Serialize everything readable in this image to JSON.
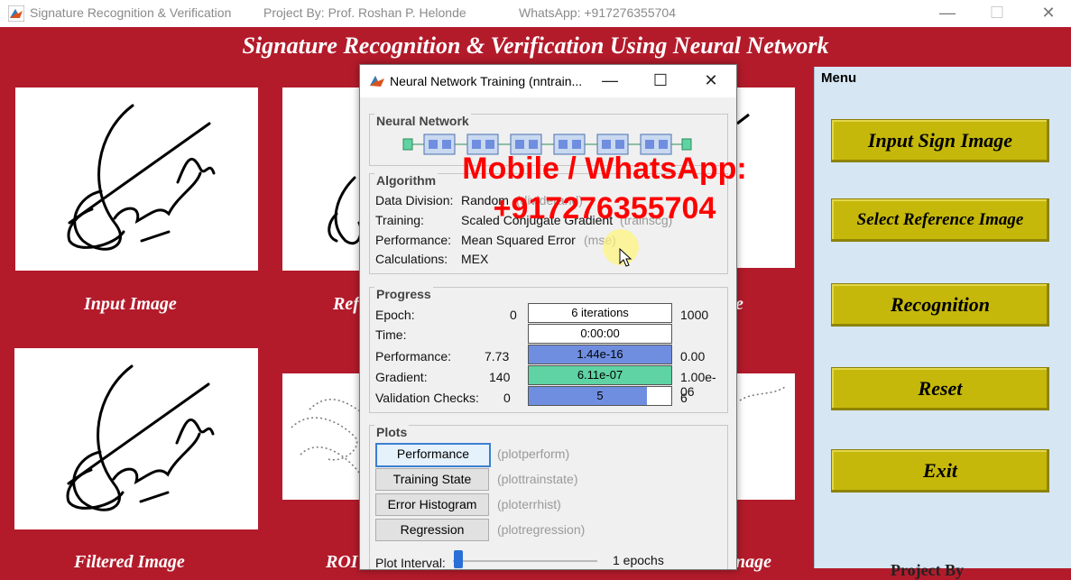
{
  "window": {
    "title": "Signature Recognition & Verification",
    "project": "Project By: Prof. Roshan P. Helonde",
    "whatsapp": "WhatsApp: +917276355704",
    "minimize": "—",
    "maximize": "☐",
    "close": "✕"
  },
  "banner": "Signature Recognition & Verification Using Neural Network",
  "panels": {
    "input_caption": "Input Image",
    "ref_caption": "Ref",
    "third_caption": "e",
    "filtered_caption": "Filtered Image",
    "roi_caption": "ROI",
    "sixth_caption": "nage"
  },
  "menu": {
    "title": "Menu",
    "buttons": [
      "Input Sign Image",
      "Select Reference Image",
      "Recognition",
      "Reset",
      "Exit"
    ],
    "footer": "Project By"
  },
  "dialog": {
    "title": "Neural Network Training (nntrain...",
    "minimize": "—",
    "maximize": "☐",
    "close": "✕",
    "network_title": "Neural Network",
    "algorithms": {
      "title": "Algorithm",
      "rows": [
        {
          "label": "Data Division:",
          "value": "Random",
          "code": "(dividerand)"
        },
        {
          "label": "Training:",
          "value": "Scaled Conjugate Gradient",
          "code": "(trainscg)"
        },
        {
          "label": "Performance:",
          "value": "Mean Squared Error",
          "code": "(mse)"
        },
        {
          "label": "Calculations:",
          "value": "MEX",
          "code": ""
        }
      ]
    },
    "progress": {
      "title": "Progress",
      "rows": [
        {
          "label": "Epoch:",
          "start": "0",
          "text": "6 iterations",
          "end": "1000",
          "fill": 0,
          "color": "#ffffff"
        },
        {
          "label": "Time:",
          "start": "",
          "text": "0:00:00",
          "end": "",
          "fill": 0,
          "color": "#ffffff"
        },
        {
          "label": "Performance:",
          "start": "7.73",
          "text": "1.44e-16",
          "end": "0.00",
          "fill": 1.0,
          "color": "#6f8ee0"
        },
        {
          "label": "Gradient:",
          "start": "140",
          "text": "6.11e-07",
          "end": "1.00e-06",
          "fill": 1.0,
          "color": "#5fd3a3"
        },
        {
          "label": "Validation Checks:",
          "start": "0",
          "text": "5",
          "end": "6",
          "fill": 0.83,
          "color": "#6f8ee0"
        }
      ]
    },
    "plots": {
      "title": "Plots",
      "buttons": [
        {
          "label": "Performance",
          "fn": "(plotperform)"
        },
        {
          "label": "Training State",
          "fn": "(plottrainstate)"
        },
        {
          "label": "Error Histogram",
          "fn": "(ploterrhist)"
        },
        {
          "label": "Regression",
          "fn": "(plotregression)"
        }
      ],
      "interval_label": "Plot Interval:",
      "interval_value": "1 epochs"
    }
  },
  "watermark": {
    "line1": "Mobile / WhatsApp:",
    "line2": "+917276355704"
  }
}
